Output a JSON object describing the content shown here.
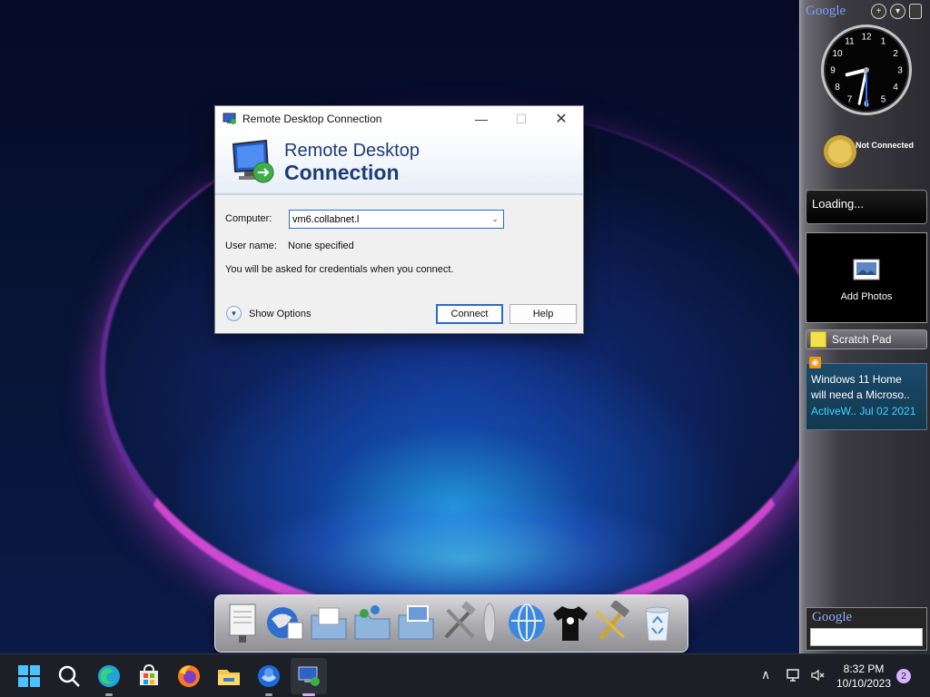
{
  "window": {
    "title": "Remote Desktop Connection",
    "minimize": "—",
    "maximize": "☐",
    "close": "✕",
    "banner_line1": "Remote Desktop",
    "banner_line2": "Connection"
  },
  "form": {
    "computer_label": "Computer:",
    "computer_value": "vm6.collabnet.l",
    "username_label": "User name:",
    "username_value": "None specified",
    "credentials_note": "You will be asked for credentials when you connect.",
    "show_options": "Show Options",
    "connect": "Connect",
    "help": "Help"
  },
  "sidebar": {
    "brand": "Google",
    "add": "+",
    "menu": "▾",
    "clock": {
      "hour": 8,
      "minute": 32,
      "second": 30
    },
    "weather_status": "Not Connected",
    "loading_text": "Loading...",
    "photos_label": "Add Photos",
    "scratch_pad": "Scratch Pad",
    "news": {
      "line1": "Windows 11 Home",
      "line2": "will need a Microso..",
      "meta": "ActiveW..  Jul 02 2021"
    },
    "search_brand": "Google"
  },
  "taskbar": {
    "time": "8:32 PM",
    "date": "10/10/2023",
    "notifications": "2",
    "chevron": "∧"
  },
  "colors": {
    "accent": "#2a6ad5",
    "banner_text": "#1d3d7a",
    "news_meta": "#3fd2ff"
  }
}
